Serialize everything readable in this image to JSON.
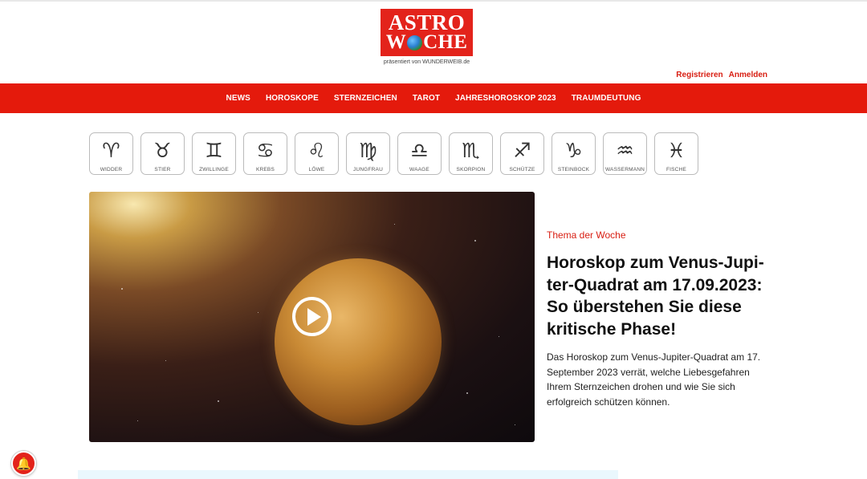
{
  "brand": {
    "logo_line1": "ASTRO",
    "logo_line2_a": "W",
    "logo_line2_b": "CHE",
    "subline": "präsentiert von WUNDERWEIB.de",
    "color": "#e3231b"
  },
  "auth": {
    "register": "Registrieren",
    "login": "Anmelden"
  },
  "nav": {
    "items": [
      "NEWS",
      "HOROSKOPE",
      "STERNZEICHEN",
      "TAROT",
      "JAHRESHOROSKOP 2023",
      "TRAUMDEUTUNG"
    ],
    "color": "#e41a0c"
  },
  "zodiac": [
    {
      "label": "WIDDER",
      "icon": "aries-icon",
      "glyph": "♈"
    },
    {
      "label": "STIER",
      "icon": "taurus-icon",
      "glyph": "♉"
    },
    {
      "label": "ZWILLINGE",
      "icon": "gemini-icon",
      "glyph": "♊"
    },
    {
      "label": "KREBS",
      "icon": "cancer-icon",
      "glyph": "♋"
    },
    {
      "label": "LÖWE",
      "icon": "leo-icon",
      "glyph": "♌"
    },
    {
      "label": "JUNGFRAU",
      "icon": "virgo-icon",
      "glyph": "♍"
    },
    {
      "label": "WAAGE",
      "icon": "libra-icon",
      "glyph": "♎"
    },
    {
      "label": "SKORPION",
      "icon": "scorpio-icon",
      "glyph": "♏"
    },
    {
      "label": "SCHÜTZE",
      "icon": "sagittarius-icon",
      "glyph": "♐"
    },
    {
      "label": "STEINBOCK",
      "icon": "capricorn-icon",
      "glyph": "♑"
    },
    {
      "label": "WASSERMANN",
      "icon": "aquarius-icon",
      "glyph": "♒"
    },
    {
      "label": "FISCHE",
      "icon": "pisces-icon",
      "glyph": "♓"
    }
  ],
  "hero": {
    "image": "venus-planet-in-space",
    "play_icon": "play-icon"
  },
  "article": {
    "kicker": "Thema der Woche",
    "headline": "Horoskop zum Venus-Jupi­ter-Quadrat am 17.09.2023: So überstehen Sie diese kritische Phase!",
    "teaser": "Das Horoskop zum Venus-Jupiter-Quadrat am 17. September 2023 verrät, welche Liebesgefahren Ihrem Sternzeichen drohen und wie Sie sich erfolgreich schützen können.",
    "accent": "#d81e12"
  },
  "notification": {
    "icon": "bell-icon"
  }
}
